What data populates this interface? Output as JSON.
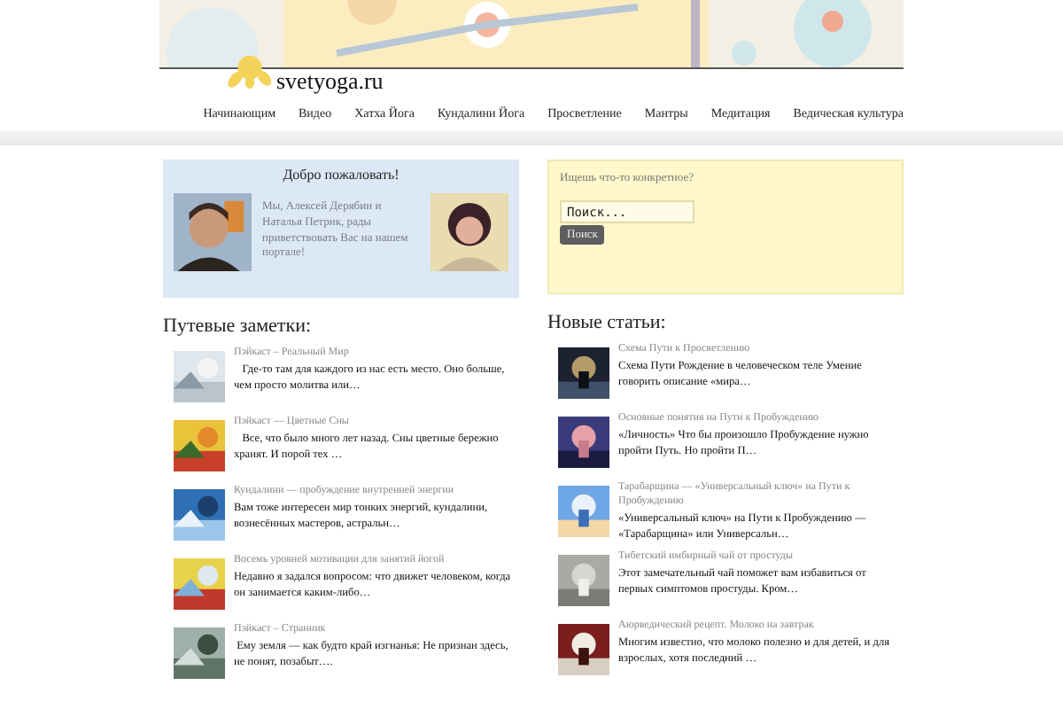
{
  "header": {
    "logo_text": "svetyoga.ru"
  },
  "nav": [
    {
      "label": "Начинающим",
      "selected": false
    },
    {
      "label": "Видео",
      "selected": false
    },
    {
      "label": "Хатха Йога",
      "selected": false
    },
    {
      "label": "Кундалини Йога",
      "selected": false
    },
    {
      "label": "Просветление",
      "selected": false
    },
    {
      "label": "Мантры",
      "selected": false
    },
    {
      "label": "Медитация",
      "selected": false
    },
    {
      "label": "Ведическая культура",
      "selected": false
    }
  ],
  "welcome": {
    "title": "Добро пожаловать!",
    "text": "Мы, Алексей Дерябин и Наталья Петрик, рады приветствовать Вас на нашем портале!"
  },
  "search": {
    "label": "Ищешь что-то конкретное?",
    "placeholder": "Поиск...",
    "button": "Поиск"
  },
  "travel_notes": {
    "title": "Путевые заметки:",
    "items": [
      {
        "title": "Пэйкаст – Реальный Мир",
        "excerpt": "   Где-то там для каждого из нас есть место. Оно больше, чем просто молитва или…"
      },
      {
        "title": "Пэйкаст — Цветные Сны",
        "excerpt": "   Все, что было много лет назад. Сны цветные бережно хранят. И порой тех …"
      },
      {
        "title": "Кундалини — пробуждение внутренней энергии",
        "excerpt": "Вам тоже интересен мир тонких энергий, кундалини, вознесённых мастеров, астральн…"
      },
      {
        "title": "Восемь уровней мотивации для занятий йогой",
        "excerpt": "Недавно я задался вопросом: что движет человеком, когда он занимается каким-либо…"
      },
      {
        "title": "Пэйкаст – Странник",
        "excerpt": " Ему земля — как будто край изгнанья: Не признан здесь, не понят, позабыт…."
      }
    ]
  },
  "new_articles": {
    "title": "Новые статьи:",
    "items": [
      {
        "title": "Схема Пути к Просветлению",
        "excerpt": "Схема Пути Рождение в человеческом теле Умение говорить описание «мира…"
      },
      {
        "title": "Основные понятия на Пути к Пробуждению",
        "excerpt": "«Личность» Что бы произошло Пробуждение нужно пройти Путь. Но пройти П…"
      },
      {
        "title": "Тарабарщина — «Универсальный ключ» на Пути к Пробуждению",
        "excerpt": "«Универсальный ключ» на Пути к Пробуждению — «Тарабарщина» или Универсальн…"
      },
      {
        "title": "Тибетский имбирный чай от простуды",
        "excerpt": "Этот замечательный чай поможет вам избавиться от первых симптомов простуды. Кром…"
      },
      {
        "title": "Аюрведический рецепт. Молоко на завтрак",
        "excerpt": "Многим известно, что молоко полезно и для детей, и для взрослых, хотя последний …"
      }
    ]
  }
}
